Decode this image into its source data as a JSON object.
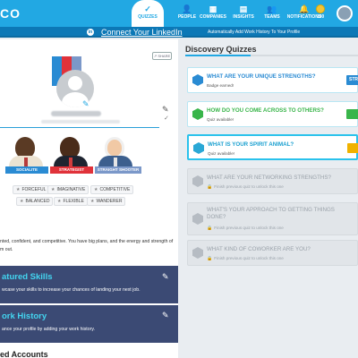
{
  "app": {
    "logo": "CO"
  },
  "nav": {
    "items": [
      {
        "label": "QUIZZES",
        "icon": "✓",
        "active": true
      },
      {
        "label": "PEOPLE",
        "icon": "👤"
      },
      {
        "label": "COMPANIES",
        "icon": "▦"
      },
      {
        "label": "INSIGHTS",
        "icon": "▤"
      },
      {
        "label": "TEAMS",
        "icon": "👥"
      },
      {
        "label": "NOTIFICATIONS",
        "icon": "🔔"
      },
      {
        "label": "100",
        "icon": "coin"
      }
    ]
  },
  "linkedin": {
    "icon": "in",
    "link_text": "Connect Your LinkedIn",
    "cta": "Automatically Add Work History To Your Profile"
  },
  "profile": {
    "share_label": "SHARE",
    "personas": [
      {
        "label": "SOCIALITE",
        "color": "#2a8bd3"
      },
      {
        "label": "STRATEGIST",
        "color": "#e0323a"
      },
      {
        "label": "STRAIGHT SHOOTER",
        "color": "#7b98c9"
      }
    ],
    "traits": [
      "FORCEFUL",
      "IMAGINATIVE",
      "COMPETITIVE",
      "BALANCED",
      "FLEXIBLE",
      "WANDERER"
    ],
    "description_line1": "nted, confident, and competitive. You have big plans, and the energy and strength of",
    "description_line2": "m out."
  },
  "featured_skills": {
    "title": "atured Skills",
    "subtitle": "wcase your skills to increase your chances of landing your next job."
  },
  "work_history": {
    "title": "ork History",
    "subtitle": "ance your profile by adding your work history."
  },
  "linked_accounts": {
    "title": "ed Accounts"
  },
  "discovery": {
    "title": "Discovery Quizzes",
    "progress_fraction": 0.38,
    "quizzes": [
      {
        "title": "WHAT ARE YOUR UNIQUE STRENGTHS?",
        "status": "Badge earned!",
        "state": "done",
        "button": "STR",
        "icon_color": "#2a8bd3",
        "title_color": "#2a8bd3",
        "btn_color": "#2a8bd3"
      },
      {
        "title": "HOW DO YOU COME ACROSS TO OTHERS?",
        "status": "Quiz available!",
        "state": "available",
        "button": "",
        "icon_color": "#39b54a",
        "title_color": "#39b54a",
        "btn_color": "#39b54a"
      },
      {
        "title": "WHAT IS YOUR SPIRIT ANIMAL?",
        "status": "Quiz available!",
        "state": "current",
        "button": "",
        "icon_color": "#2aa8d6",
        "title_color": "#1aa0d0",
        "btn_color": "#f0b200"
      },
      {
        "title": "WHAT ARE YOUR NETWORKING STRENGTHS?",
        "status": "Finish previous quiz to unlock this one",
        "state": "locked"
      },
      {
        "title": "WHAT'S YOUR APPROACH TO GETTING THINGS",
        "title2": "DONE?",
        "status": "Finish previous quiz to unlock this one",
        "state": "locked"
      },
      {
        "title": "WHAT KIND OF COWORKER ARE YOU?",
        "status": "Finish previous quiz to unlock this one",
        "state": "locked"
      }
    ]
  }
}
